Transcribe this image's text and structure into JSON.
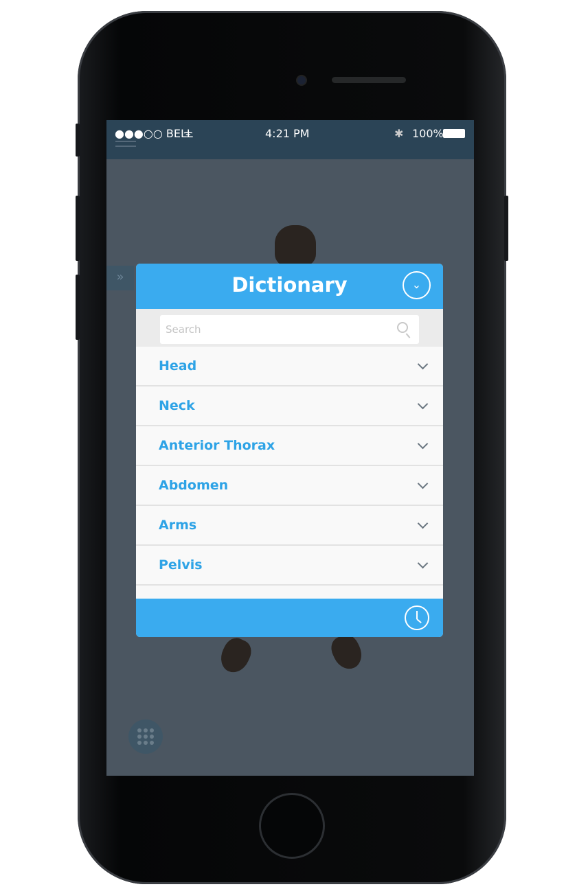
{
  "status_bar": {
    "carrier": "●●●○○ BELL",
    "time": "4:21 PM",
    "battery": "100%"
  },
  "dialog": {
    "title": "Dictionary",
    "search_placeholder": "Search",
    "items": [
      {
        "label": "Head"
      },
      {
        "label": "Neck"
      },
      {
        "label": "Anterior Thorax"
      },
      {
        "label": "Abdomen"
      },
      {
        "label": "Arms"
      },
      {
        "label": "Pelvis"
      }
    ]
  },
  "colors": {
    "accent": "#3aabef",
    "item_text": "#2ea3e6",
    "status_bar": "#2b4456"
  }
}
